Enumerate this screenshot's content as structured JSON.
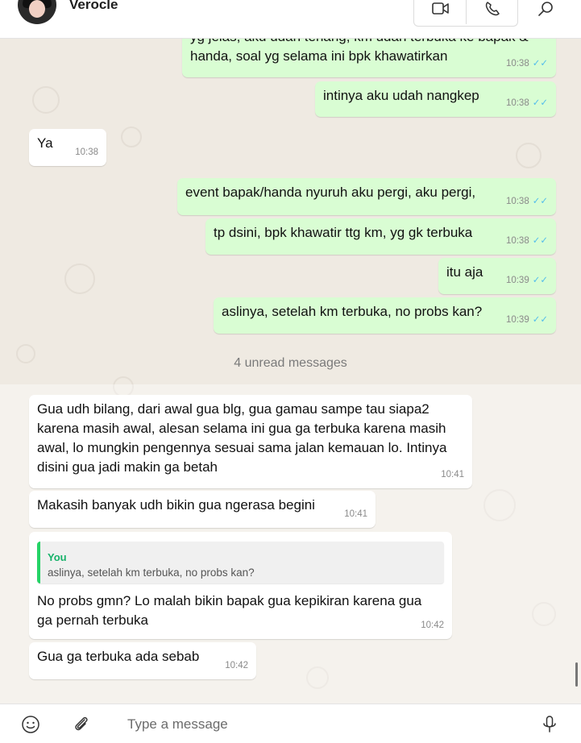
{
  "contact": {
    "name": "Verocle"
  },
  "header": {
    "video_icon": "video-call-icon",
    "voice_icon": "voice-call-icon",
    "search_icon": "search-icon"
  },
  "messages_before": [
    {
      "dir": "out",
      "lines": [
        "yg jelas, aku udah tenang, km udah terbuka ke bapak &",
        "handa, soal yg selama ini bpk khawatirkan"
      ],
      "time": "10:38"
    },
    {
      "dir": "out",
      "lines": [
        "intinya aku udah nangkep"
      ],
      "time": "10:38"
    },
    {
      "dir": "in",
      "lines": [
        "Ya"
      ],
      "time": "10:38"
    },
    {
      "dir": "out",
      "lines": [
        "event bapak/handa nyuruh aku pergi, aku pergi,"
      ],
      "time": "10:38"
    },
    {
      "dir": "out",
      "lines": [
        "tp dsini, bpk khawatir ttg km, yg gk terbuka"
      ],
      "time": "10:38"
    },
    {
      "dir": "out",
      "lines": [
        "itu aja"
      ],
      "time": "10:39"
    },
    {
      "dir": "out",
      "lines": [
        "aslinya, setelah km terbuka, no probs kan?"
      ],
      "time": "10:39"
    }
  ],
  "unread_label": "4 unread messages",
  "messages_after": [
    {
      "dir": "in",
      "lines": [
        "Gua udh bilang, dari awal gua blg, gua gamau sampe tau siapa2",
        "karena masih awal, alesan selama ini gua ga terbuka karena masih",
        "awal, lo mungkin pengennya sesuai sama jalan kemauan lo. Intinya",
        "disini gua jadi makin ga betah"
      ],
      "time": "10:41"
    },
    {
      "dir": "in",
      "lines": [
        "Makasih banyak udh bikin gua ngerasa begini"
      ],
      "time": "10:41"
    },
    {
      "dir": "in",
      "quote": {
        "author": "You",
        "text": "aslinya, setelah km terbuka, no probs kan?"
      },
      "lines": [
        "No probs gmn? Lo malah bikin bapak gua kepikiran karena gua",
        "ga pernah terbuka"
      ],
      "time": "10:42"
    },
    {
      "dir": "in",
      "lines": [
        "Gua ga terbuka ada sebab"
      ],
      "time": "10:42"
    }
  ],
  "composer": {
    "placeholder": "Type a message",
    "emoji_icon": "emoji-icon",
    "attach_icon": "paperclip-icon",
    "mic_icon": "microphone-icon"
  },
  "colors": {
    "outgoing": "#d9fdd3",
    "incoming": "#ffffff",
    "read_ticks": "#53bdeb",
    "quote_bar": "#25d366"
  }
}
